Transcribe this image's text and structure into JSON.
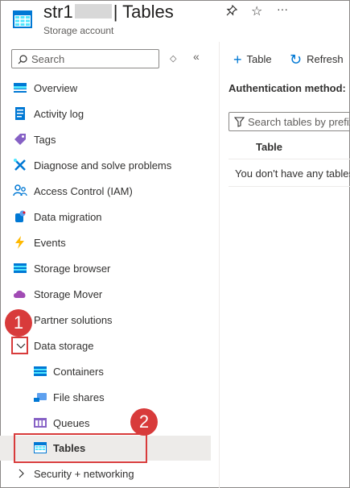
{
  "header": {
    "title_prefix": "str1",
    "title_suffix": "| Tables",
    "subtitle": "Storage account",
    "pin_icon": "pin-icon",
    "star_icon": "star-icon",
    "more_icon": "ellipsis-icon"
  },
  "sidebar": {
    "search_placeholder": "Search",
    "items": [
      {
        "label": "Overview",
        "icon": "overview-icon"
      },
      {
        "label": "Activity log",
        "icon": "activity-log-icon"
      },
      {
        "label": "Tags",
        "icon": "tag-icon"
      },
      {
        "label": "Diagnose and solve problems",
        "icon": "wrench-icon"
      },
      {
        "label": "Access Control (IAM)",
        "icon": "people-icon"
      },
      {
        "label": "Data migration",
        "icon": "data-migration-icon"
      },
      {
        "label": "Events",
        "icon": "lightning-icon"
      },
      {
        "label": "Storage browser",
        "icon": "storage-browser-icon"
      },
      {
        "label": "Storage Mover",
        "icon": "cloud-icon"
      },
      {
        "label": "Partner solutions",
        "icon": "partner-icon"
      }
    ],
    "data_storage": {
      "label": "Data storage",
      "children": [
        {
          "label": "Containers",
          "icon": "containers-icon"
        },
        {
          "label": "File shares",
          "icon": "file-shares-icon"
        },
        {
          "label": "Queues",
          "icon": "queues-icon"
        },
        {
          "label": "Tables",
          "icon": "tables-icon",
          "selected": true
        }
      ]
    },
    "security": {
      "label": "Security + networking"
    }
  },
  "toolbar": {
    "add_table": "Table",
    "refresh": "Refresh"
  },
  "main": {
    "auth_label": "Authentication method:",
    "filter_placeholder": "Search tables by prefix",
    "column_header": "Table",
    "empty_message": "You don't have any tables"
  },
  "callouts": {
    "step1": "1",
    "step2": "2"
  },
  "colors": {
    "accent": "#0078d4",
    "callout": "#d83b3b",
    "selected_bg": "#edebe9"
  }
}
